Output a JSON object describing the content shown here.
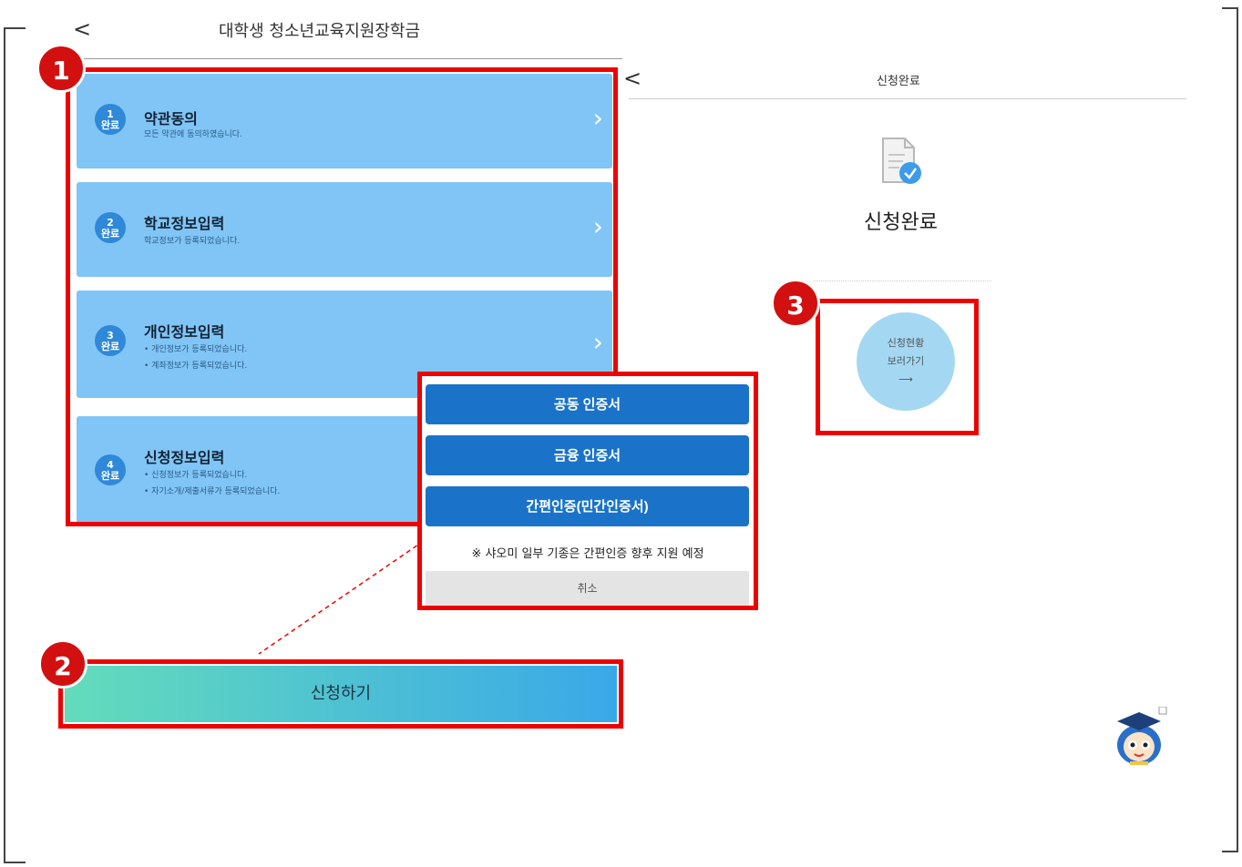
{
  "left_header": {
    "back_glyph": "<",
    "title": "대학생 청소년교육지원장학금"
  },
  "right_header": {
    "back_glyph": "<",
    "title": "신청완료"
  },
  "steps": [
    {
      "num": "1",
      "status": "완료",
      "title": "약관동의",
      "desc": [
        "모든 약관에 동의하였습니다."
      ]
    },
    {
      "num": "2",
      "status": "완료",
      "title": "학교정보입력",
      "desc": [
        "학교정보가 등록되었습니다."
      ]
    },
    {
      "num": "3",
      "status": "완료",
      "title": "개인정보입력",
      "desc": [
        "• 개인정보가 등록되었습니다.",
        "• 계좌정보가 등록되었습니다."
      ]
    },
    {
      "num": "4",
      "status": "완료",
      "title": "신청정보입력",
      "desc": [
        "• 신청정보가 등록되었습니다.",
        "• 자기소개/제출서류가 등록되었습니다."
      ]
    }
  ],
  "step_arrow": "›",
  "markers": {
    "one": "1",
    "two": "2",
    "three": "3"
  },
  "popup": {
    "btn1": "공동 인증서",
    "btn2": "금융 인증서",
    "btn3": "간편인증(민간인증서)",
    "note": "※ 샤오미 일부 기종은 간편인증 향후 지원 예정",
    "cancel": "취소"
  },
  "apply_label": "신청하기",
  "done": {
    "title": "신청완료",
    "status_line1": "신청현황",
    "status_line2": "보러가기",
    "status_arrow": "⟶"
  },
  "icons": {
    "document": "document-check-icon",
    "mascot": "graduate-mascot-icon"
  },
  "colors": {
    "highlight": "#ee0000",
    "step_bg": "#80c5f5",
    "popup_btn": "#1a73c8",
    "status_circle": "#a4d8f2"
  }
}
